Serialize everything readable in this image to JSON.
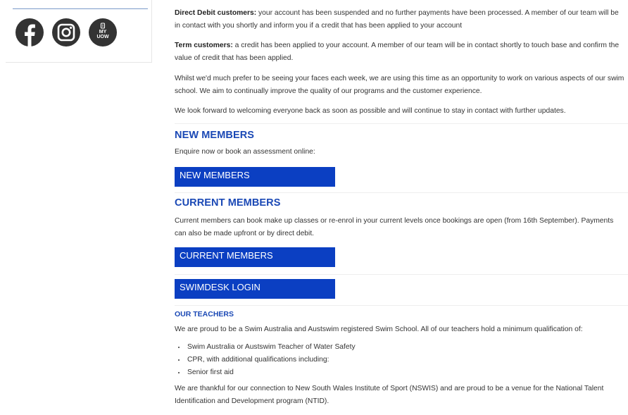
{
  "sidebar": {
    "icons": {
      "facebook": "facebook-icon",
      "instagram": "instagram-icon",
      "myuow": "myuow-icon"
    },
    "myuow_text": {
      "line1": "MY",
      "line2": "UOW"
    }
  },
  "notice": {
    "direct_debit_lead": "Direct Debit customers:",
    "direct_debit_text": " your account has been suspended and no further payments have been processed. A member of our team will be in contact with you shortly and inform you if a credit that has been applied to your account",
    "term_lead": "Term customers:",
    "term_text": " a credit has been applied to your account. A member of our team will be in contact shortly to touch base and confirm the value of credit that has been applied.",
    "whilst": "Whilst we'd much prefer to be seeing your faces each week, we are using this time as an opportunity to work on various aspects of our swim school. We aim to continually improve the quality of our programs and the customer experience.",
    "look_forward": "We look forward to welcoming everyone back as soon as possible and will continue to stay in contact with further updates."
  },
  "new_members": {
    "heading": "NEW MEMBERS",
    "text": "Enquire now or book an assessment online:",
    "button_label": "NEW MEMBERS"
  },
  "current_members": {
    "heading": "CURRENT MEMBERS",
    "text": "Current members can book make up classes or re-enrol in your current levels once bookings are open (from 16th September). Payments can also be made upfront or by direct debit.",
    "button_label": "CURRENT MEMBERS"
  },
  "swimdesk": {
    "button_label": "SWIMDESK LOGIN"
  },
  "teachers": {
    "heading": "OUR TEACHERS",
    "intro": "We are proud to be a Swim Australia and Austswim registered Swim School.  All of our teachers hold a minimum qualification of:",
    "qualifications": [
      "Swim Australia or Austswim Teacher of Water Safety",
      "CPR, with additional qualifications including:",
      "Senior first aid"
    ],
    "closing": "We are thankful for our connection to New South Wales Institute of Sport (NSWIS) and are proud to be a venue for the National Talent Identification and Development program (NTID)."
  },
  "colors": {
    "accent": "#1a48b5",
    "button": "#0b3fc2",
    "icon": "#333333"
  }
}
